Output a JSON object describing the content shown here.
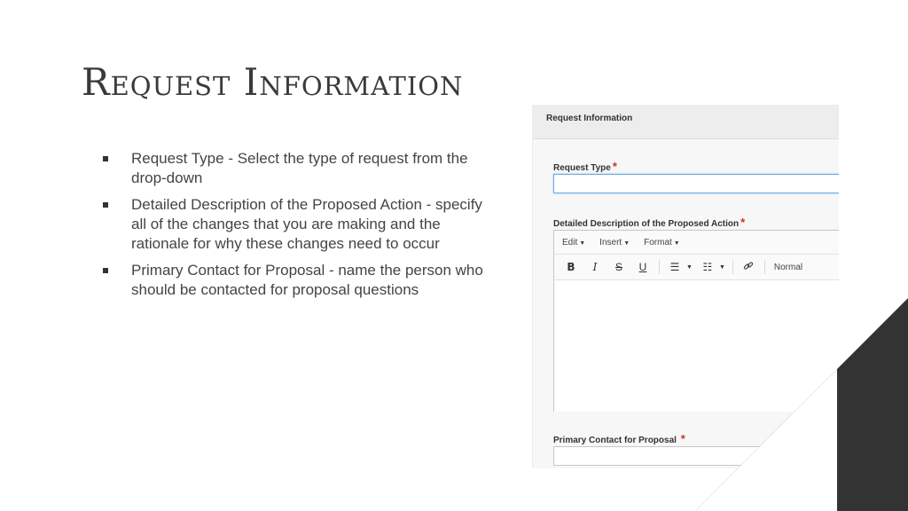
{
  "slide": {
    "title": "Request Information",
    "bullets": [
      {
        "text": "Request Type - Select the type of request from the drop-down"
      },
      {
        "text": "Detailed Description of the Proposed Action - specify all of the changes that you are making and the rationale for why these changes need to occur"
      },
      {
        "text": "Primary Contact for Proposal - name the person who should be contacted for proposal questions"
      }
    ]
  },
  "form": {
    "header": "Request Information",
    "required_mark": "*",
    "request_type": {
      "label": "Request Type",
      "value": ""
    },
    "description": {
      "label": "Detailed Description of the Proposed Action",
      "menus": [
        "Edit",
        "Insert",
        "Format"
      ],
      "toolbar": {
        "bold": "B",
        "italic": "I",
        "strike": "S",
        "underline": "U",
        "format_value": "Normal"
      },
      "value": ""
    },
    "primary_contact": {
      "label": "Primary Contact for Proposal",
      "value": ""
    }
  },
  "colors": {
    "required": "#d32f2f",
    "corner_dark": "#333333",
    "focus_border": "#6ea7e0"
  }
}
